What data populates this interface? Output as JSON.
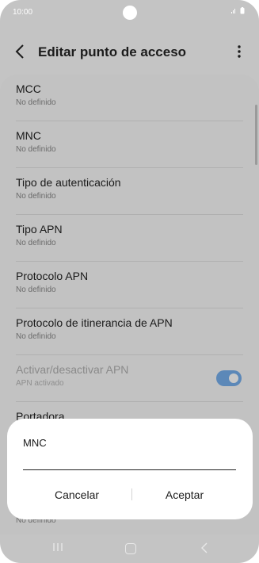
{
  "status": {
    "time": "10:00",
    "icons": "signal-icon battery-icon"
  },
  "header": {
    "title": "Editar punto de acceso"
  },
  "list": {
    "items": [
      {
        "title": "MCC",
        "subtitle": "No definido"
      },
      {
        "title": "MNC",
        "subtitle": "No definido"
      },
      {
        "title": "Tipo de autenticación",
        "subtitle": "No definido"
      },
      {
        "title": "Tipo APN",
        "subtitle": "No definido"
      },
      {
        "title": "Protocolo APN",
        "subtitle": "No definido"
      },
      {
        "title": "Protocolo de itinerancia de APN",
        "subtitle": "No definido"
      },
      {
        "title": "Activar/desactivar APN",
        "subtitle": "APN activado",
        "toggle_on": true
      },
      {
        "title": "Portadora",
        "subtitle": "No definido"
      }
    ]
  },
  "dialog": {
    "title": "MNC",
    "input_value": "",
    "input_placeholder": "",
    "cancel_label": "Cancelar",
    "accept_label": "Aceptar"
  },
  "colors": {
    "toggle_accent": "#5c88b8",
    "overlay": "#c4c4c4",
    "dialog_bg": "#ffffff"
  }
}
